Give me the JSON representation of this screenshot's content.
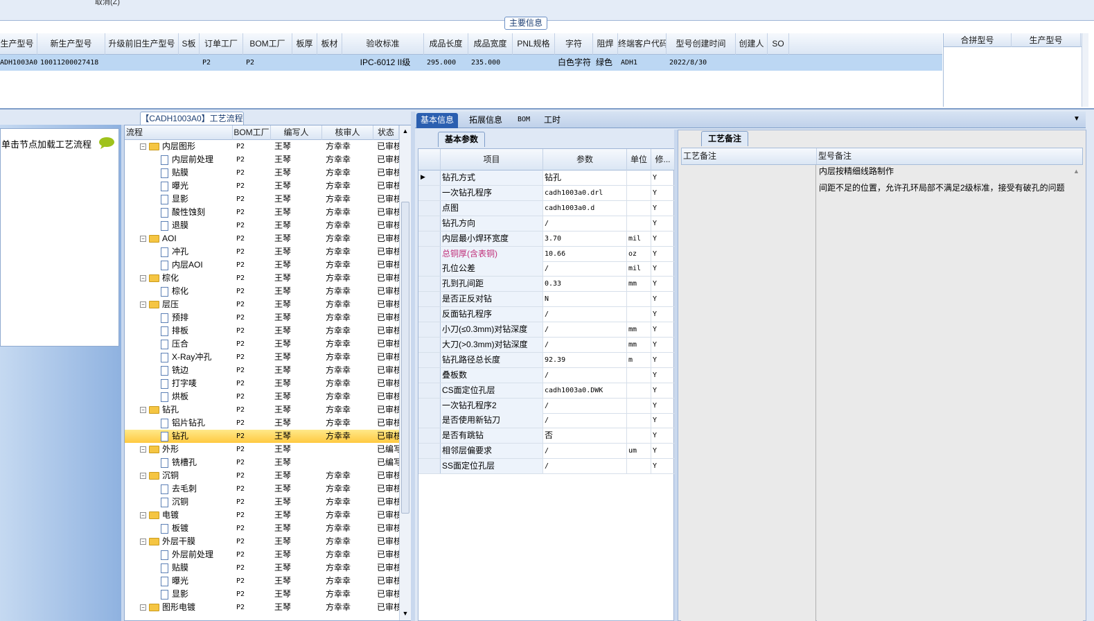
{
  "top": {
    "cancel_label": "取消(Z)"
  },
  "main_info": {
    "title": "主要信息",
    "columns": [
      "生产型号",
      "新生产型号",
      "升级前旧生产型号",
      "S板",
      "订单工厂",
      "BOM工厂",
      "板厚",
      "板材",
      "验收标准",
      "成品长度",
      "成品宽度",
      "PNL规格",
      "字符",
      "阻焊",
      "终端客户代码",
      "型号创建时间",
      "创建人",
      "SO"
    ],
    "row": [
      "ADH1003A0",
      "10011200027418",
      "",
      "",
      "P2",
      "P2",
      "",
      "",
      "IPC-6012 II级",
      "295.000",
      "235.000",
      "",
      "白色字符",
      "绿色",
      "ADH1",
      "2022/8/30",
      "",
      ""
    ],
    "merge_columns": [
      "合拼型号",
      "生产型号"
    ]
  },
  "left_panel": {
    "hint": "单击节点加载工艺流程"
  },
  "flow": {
    "tab_title": "【CADH1003A0】工艺流程",
    "columns": [
      "流程",
      "BOM工厂",
      "编写人",
      "核审人",
      "状态"
    ],
    "rows": [
      {
        "level": 1,
        "type": "folder",
        "name": "内层图形",
        "bom": "P2",
        "writer": "王琴",
        "reviewer": "方幸幸",
        "status": "已审核"
      },
      {
        "level": 2,
        "type": "doc",
        "name": "内层前处理",
        "bom": "P2",
        "writer": "王琴",
        "reviewer": "方幸幸",
        "status": "已审核"
      },
      {
        "level": 2,
        "type": "doc",
        "name": "贴膜",
        "bom": "P2",
        "writer": "王琴",
        "reviewer": "方幸幸",
        "status": "已审核"
      },
      {
        "level": 2,
        "type": "doc",
        "name": "曝光",
        "bom": "P2",
        "writer": "王琴",
        "reviewer": "方幸幸",
        "status": "已审核"
      },
      {
        "level": 2,
        "type": "doc",
        "name": "显影",
        "bom": "P2",
        "writer": "王琴",
        "reviewer": "方幸幸",
        "status": "已审核"
      },
      {
        "level": 2,
        "type": "doc",
        "name": "酸性蚀刻",
        "bom": "P2",
        "writer": "王琴",
        "reviewer": "方幸幸",
        "status": "已审核"
      },
      {
        "level": 2,
        "type": "doc",
        "name": "退膜",
        "bom": "P2",
        "writer": "王琴",
        "reviewer": "方幸幸",
        "status": "已审核"
      },
      {
        "level": 1,
        "type": "folder",
        "name": "AOI",
        "bom": "P2",
        "writer": "王琴",
        "reviewer": "方幸幸",
        "status": "已审核"
      },
      {
        "level": 2,
        "type": "doc",
        "name": "冲孔",
        "bom": "P2",
        "writer": "王琴",
        "reviewer": "方幸幸",
        "status": "已审核"
      },
      {
        "level": 2,
        "type": "doc",
        "name": "内层AOI",
        "bom": "P2",
        "writer": "王琴",
        "reviewer": "方幸幸",
        "status": "已审核"
      },
      {
        "level": 1,
        "type": "folder",
        "name": "棕化",
        "bom": "P2",
        "writer": "王琴",
        "reviewer": "方幸幸",
        "status": "已审核"
      },
      {
        "level": 2,
        "type": "doc",
        "name": "棕化",
        "bom": "P2",
        "writer": "王琴",
        "reviewer": "方幸幸",
        "status": "已审核"
      },
      {
        "level": 1,
        "type": "folder",
        "name": "层压",
        "bom": "P2",
        "writer": "王琴",
        "reviewer": "方幸幸",
        "status": "已审核"
      },
      {
        "level": 2,
        "type": "doc",
        "name": "预排",
        "bom": "P2",
        "writer": "王琴",
        "reviewer": "方幸幸",
        "status": "已审核"
      },
      {
        "level": 2,
        "type": "doc",
        "name": "排板",
        "bom": "P2",
        "writer": "王琴",
        "reviewer": "方幸幸",
        "status": "已审核"
      },
      {
        "level": 2,
        "type": "doc",
        "name": "压合",
        "bom": "P2",
        "writer": "王琴",
        "reviewer": "方幸幸",
        "status": "已审核"
      },
      {
        "level": 2,
        "type": "doc",
        "name": "X-Ray冲孔",
        "bom": "P2",
        "writer": "王琴",
        "reviewer": "方幸幸",
        "status": "已审核"
      },
      {
        "level": 2,
        "type": "doc",
        "name": "铣边",
        "bom": "P2",
        "writer": "王琴",
        "reviewer": "方幸幸",
        "status": "已审核"
      },
      {
        "level": 2,
        "type": "doc",
        "name": "打字唛",
        "bom": "P2",
        "writer": "王琴",
        "reviewer": "方幸幸",
        "status": "已审核"
      },
      {
        "level": 2,
        "type": "doc",
        "name": "烘板",
        "bom": "P2",
        "writer": "王琴",
        "reviewer": "方幸幸",
        "status": "已审核"
      },
      {
        "level": 1,
        "type": "folder",
        "name": "钻孔",
        "bom": "P2",
        "writer": "王琴",
        "reviewer": "方幸幸",
        "status": "已审核"
      },
      {
        "level": 2,
        "type": "doc",
        "name": "铝片钻孔",
        "bom": "P2",
        "writer": "王琴",
        "reviewer": "方幸幸",
        "status": "已审核"
      },
      {
        "level": 2,
        "type": "doc",
        "name": "钻孔",
        "bom": "P2",
        "writer": "王琴",
        "reviewer": "方幸幸",
        "status": "已审核",
        "selected": true
      },
      {
        "level": 1,
        "type": "folder",
        "name": "外形",
        "bom": "P2",
        "writer": "王琴",
        "reviewer": "",
        "status": "已编写"
      },
      {
        "level": 2,
        "type": "doc",
        "name": "铣槽孔",
        "bom": "P2",
        "writer": "王琴",
        "reviewer": "",
        "status": "已编写"
      },
      {
        "level": 1,
        "type": "folder",
        "name": "沉铜",
        "bom": "P2",
        "writer": "王琴",
        "reviewer": "方幸幸",
        "status": "已审核"
      },
      {
        "level": 2,
        "type": "doc",
        "name": "去毛刺",
        "bom": "P2",
        "writer": "王琴",
        "reviewer": "方幸幸",
        "status": "已审核"
      },
      {
        "level": 2,
        "type": "doc",
        "name": "沉铜",
        "bom": "P2",
        "writer": "王琴",
        "reviewer": "方幸幸",
        "status": "已审核"
      },
      {
        "level": 1,
        "type": "folder",
        "name": "电镀",
        "bom": "P2",
        "writer": "王琴",
        "reviewer": "方幸幸",
        "status": "已审核"
      },
      {
        "level": 2,
        "type": "doc",
        "name": "板镀",
        "bom": "P2",
        "writer": "王琴",
        "reviewer": "方幸幸",
        "status": "已审核"
      },
      {
        "level": 1,
        "type": "folder",
        "name": "外层干膜",
        "bom": "P2",
        "writer": "王琴",
        "reviewer": "方幸幸",
        "status": "已审核"
      },
      {
        "level": 2,
        "type": "doc",
        "name": "外层前处理",
        "bom": "P2",
        "writer": "王琴",
        "reviewer": "方幸幸",
        "status": "已审核"
      },
      {
        "level": 2,
        "type": "doc",
        "name": "贴膜",
        "bom": "P2",
        "writer": "王琴",
        "reviewer": "方幸幸",
        "status": "已审核"
      },
      {
        "level": 2,
        "type": "doc",
        "name": "曝光",
        "bom": "P2",
        "writer": "王琴",
        "reviewer": "方幸幸",
        "status": "已审核"
      },
      {
        "level": 2,
        "type": "doc",
        "name": "显影",
        "bom": "P2",
        "writer": "王琴",
        "reviewer": "方幸幸",
        "status": "已审核"
      },
      {
        "level": 1,
        "type": "folder",
        "name": "图形电镀",
        "bom": "P2",
        "writer": "王琴",
        "reviewer": "方幸幸",
        "status": "已审核"
      }
    ]
  },
  "mid_tabs": [
    "基本信息",
    "拓展信息",
    "BOM",
    "工时"
  ],
  "params": {
    "tab_title": "基本参数",
    "columns": [
      "项目",
      "参数",
      "单位",
      "修..."
    ],
    "rows": [
      {
        "key": "钻孔方式",
        "value": "钻孔",
        "unit": "",
        "mod": "Y",
        "current": true
      },
      {
        "key": "一次钻孔程序",
        "value": "cadh1003a0.drl",
        "unit": "",
        "mod": "Y"
      },
      {
        "key": "点图",
        "value": "cadh1003a0.d",
        "unit": "",
        "mod": "Y"
      },
      {
        "key": "钻孔方向",
        "value": "/",
        "unit": "",
        "mod": "Y"
      },
      {
        "key": "内层最小焊环宽度",
        "value": "3.70",
        "unit": "mil",
        "mod": "Y"
      },
      {
        "key": "总铜厚(含表铜)",
        "value": "10.66",
        "unit": "oz",
        "mod": "Y",
        "highlight": true
      },
      {
        "key": "孔位公差",
        "value": "/",
        "unit": "mil",
        "mod": "Y"
      },
      {
        "key": "孔到孔间距",
        "value": "0.33",
        "unit": "mm",
        "mod": "Y"
      },
      {
        "key": "是否正反对钻",
        "value": "N",
        "unit": "",
        "mod": "Y"
      },
      {
        "key": "反面钻孔程序",
        "value": "/",
        "unit": "",
        "mod": "Y"
      },
      {
        "key": "小刀(≤0.3mm)对钻深度",
        "value": "/",
        "unit": "mm",
        "mod": "Y"
      },
      {
        "key": "大刀(>0.3mm)对钻深度",
        "value": "/",
        "unit": "mm",
        "mod": "Y"
      },
      {
        "key": "钻孔路径总长度",
        "value": "92.39",
        "unit": "m",
        "mod": "Y"
      },
      {
        "key": "叠板数",
        "value": "/",
        "unit": "",
        "mod": "Y"
      },
      {
        "key": "CS面定位孔层",
        "value": "cadh1003a0.DWK",
        "unit": "",
        "mod": "Y"
      },
      {
        "key": "一次钻孔程序2",
        "value": "/",
        "unit": "",
        "mod": "Y"
      },
      {
        "key": "是否使用新钻刀",
        "value": "/",
        "unit": "",
        "mod": "Y"
      },
      {
        "key": "是否有跳钻",
        "value": "否",
        "unit": "",
        "mod": "Y"
      },
      {
        "key": "相邻层偏要求",
        "value": "/",
        "unit": "um",
        "mod": "Y"
      },
      {
        "key": "SS面定位孔层",
        "value": "/",
        "unit": "",
        "mod": "Y"
      }
    ]
  },
  "notes": {
    "tab_title": "工艺备注",
    "col_process": "工艺备注",
    "col_model": "型号备注",
    "lines": [
      "内层按精细线路制作",
      "间距不足的位置，允许孔环局部不满足2级标准，接受有破孔的问题"
    ]
  },
  "colors": {
    "selection_row": "#bcd7f3",
    "tree_selected": "#ffd24a",
    "active_tab": "#2b5fb0",
    "highlight_key": "#c0307a"
  }
}
